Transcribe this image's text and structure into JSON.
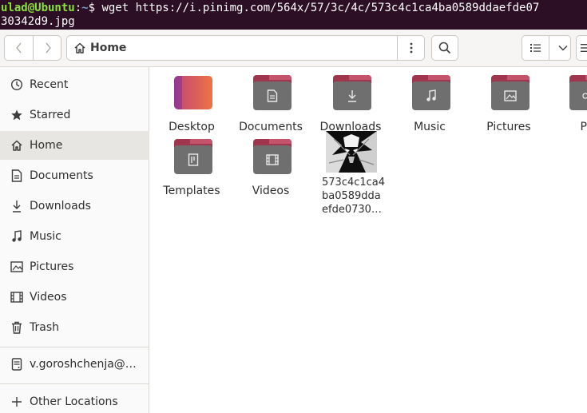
{
  "terminal": {
    "user_host": "ulad@Ubuntu",
    "colon": ":",
    "path": "~",
    "prompt_rest": "$ wget https://i.pinimg.com/564x/57/3c/4c/573c4c1ca4ba0589ddaefde07",
    "line2": "30342d9.jpg"
  },
  "header": {
    "location": "Home"
  },
  "sidebar": {
    "items": [
      {
        "label": "Recent",
        "icon": "clock-icon"
      },
      {
        "label": "Starred",
        "icon": "star-icon"
      },
      {
        "label": "Home",
        "icon": "home-icon",
        "active": true
      },
      {
        "label": "Documents",
        "icon": "document-icon"
      },
      {
        "label": "Downloads",
        "icon": "download-icon"
      },
      {
        "label": "Music",
        "icon": "music-icon"
      },
      {
        "label": "Pictures",
        "icon": "picture-icon"
      },
      {
        "label": "Videos",
        "icon": "film-icon"
      },
      {
        "label": "Trash",
        "icon": "trash-icon"
      }
    ],
    "drive": {
      "label": "v.goroshchenja@…",
      "icon": "drive-icon"
    },
    "other": {
      "label": "Other Locations",
      "icon": "plus-icon"
    }
  },
  "files": [
    {
      "name": "Desktop",
      "kind": "desktop"
    },
    {
      "name": "Documents",
      "kind": "folder",
      "glyph": "document-icon"
    },
    {
      "name": "Downloads",
      "kind": "folder",
      "glyph": "download-icon"
    },
    {
      "name": "Music",
      "kind": "folder",
      "glyph": "music-icon"
    },
    {
      "name": "Pictures",
      "kind": "folder",
      "glyph": "picture-icon"
    },
    {
      "name": "Pu",
      "kind": "folder",
      "glyph": "share-icon"
    },
    {
      "name": "Templates",
      "kind": "folder",
      "glyph": "template-icon"
    },
    {
      "name": "Videos",
      "kind": "folder",
      "glyph": "film-icon"
    },
    {
      "name": "573c4c1ca4 ba0589dda efde0730…",
      "kind": "image"
    }
  ],
  "colors": {
    "terminal_bg": "#2c0f24",
    "folder_accent": "#a0364e",
    "folder_body": "#6f6f6f"
  }
}
